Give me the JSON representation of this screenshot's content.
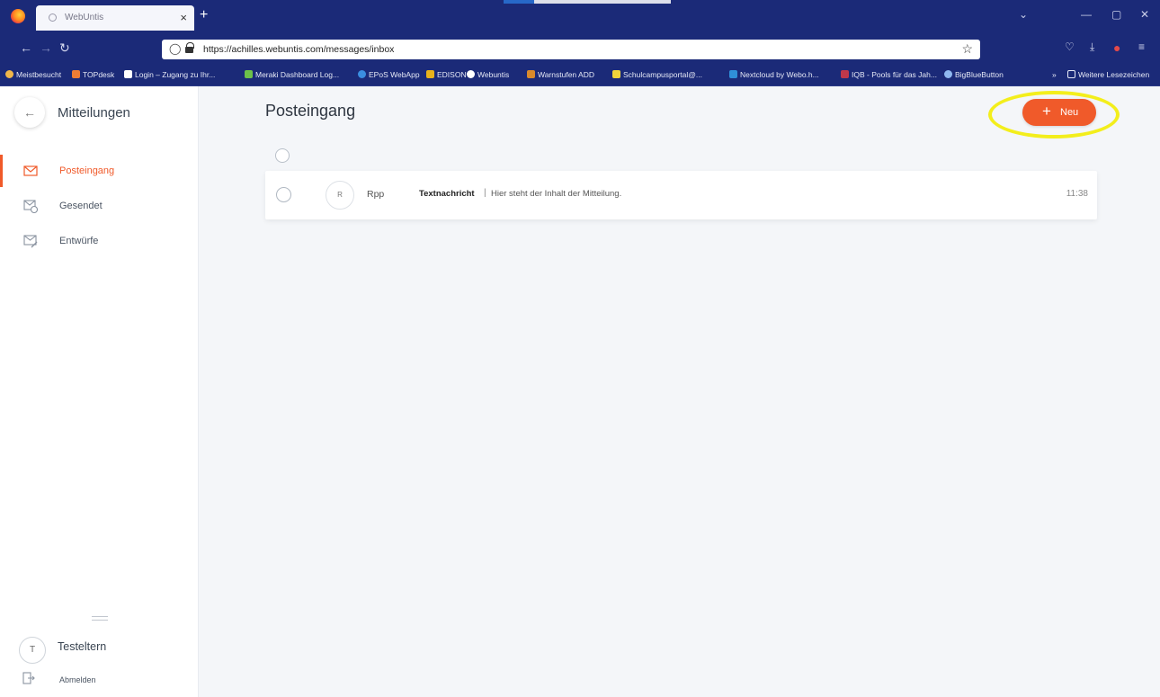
{
  "browser": {
    "tab_title": "WebUntis",
    "url": "https://achilles.webuntis.com/messages/inbox",
    "bookmarks": [
      "Meistbesucht",
      "TOPdesk",
      "Login – Zugang zu Ihr...",
      "Meraki Dashboard Log...",
      "EPoS WebApp",
      "EDISON",
      "Webuntis",
      "Warnstufen ADD",
      "Schulcampusportal@...",
      "Nextcloud by Webo.h...",
      "IQB - Pools für das Jah...",
      "BigBlueButton"
    ],
    "more_bookmarks": "Weitere Lesezeichen"
  },
  "sidebar": {
    "title": "Mitteilungen",
    "items": [
      {
        "label": "Posteingang",
        "active": true
      },
      {
        "label": "Gesendet",
        "active": false
      },
      {
        "label": "Entwürfe",
        "active": false
      }
    ],
    "user": {
      "initial": "T",
      "name": "Testeltern"
    },
    "logout_label": "Abmelden"
  },
  "main": {
    "title": "Posteingang",
    "new_button": {
      "plus": "+",
      "label": "Neu"
    },
    "messages": [
      {
        "avatar_initial": "R",
        "sender": "Rpp",
        "subject": "Textnachricht",
        "separator": "|",
        "preview": "Hier steht der Inhalt der Mitteilung.",
        "time": "11:38"
      }
    ]
  },
  "colors": {
    "accent": "#f05a2a",
    "browser_chrome": "#1b2a78",
    "highlight": "#f3ee1c"
  }
}
